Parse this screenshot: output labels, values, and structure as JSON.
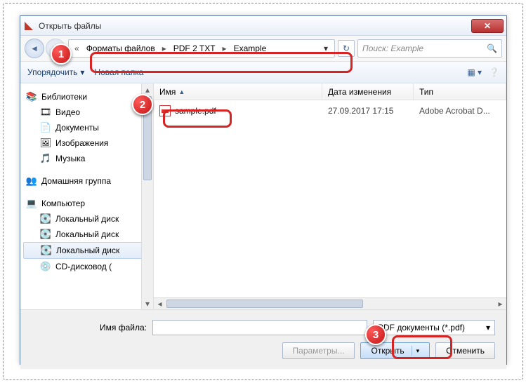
{
  "window": {
    "title": "Открыть файлы",
    "close_x": "✕"
  },
  "nav": {
    "back": "◄",
    "forward": "►",
    "dbl": "«",
    "crumb1": "Форматы файлов",
    "crumb2": "PDF 2 TXT",
    "crumb3": "Example",
    "sep": "▸",
    "dropdown": "▾",
    "refresh": "↻",
    "search_placeholder": "Поиск: Example",
    "search_icon": "🔍"
  },
  "toolbar": {
    "organize": "Упорядочить",
    "organize_caret": "▾",
    "newfolder": "Новая папка",
    "view_icon": "▦",
    "view_caret": "▾",
    "help_icon": "❔"
  },
  "sidebar": {
    "libraries": "Библиотеки",
    "video": "Видео",
    "documents": "Документы",
    "images": "Изображения",
    "music": "Музыка",
    "homegroup": "Домашняя группа",
    "computer": "Компьютер",
    "disk1": "Локальный диск",
    "disk2": "Локальный диск",
    "disk3": "Локальный диск",
    "cd": "CD-дисковод ("
  },
  "columns": {
    "name": "Имя",
    "date": "Дата изменения",
    "type": "Тип",
    "sort": "▲"
  },
  "files": [
    {
      "name": "sample.pdf",
      "date": "27.09.2017 17:15",
      "type": "Adobe Acrobat D..."
    }
  ],
  "bottom": {
    "filename_label": "Имя файла:",
    "filename_value": "",
    "filter": "PDF документы (*.pdf)",
    "params": "Параметры...",
    "open": "Открыть",
    "cancel": "Отменить",
    "caret": "▾"
  },
  "markers": {
    "m1": "1",
    "m2": "2",
    "m3": "3"
  }
}
